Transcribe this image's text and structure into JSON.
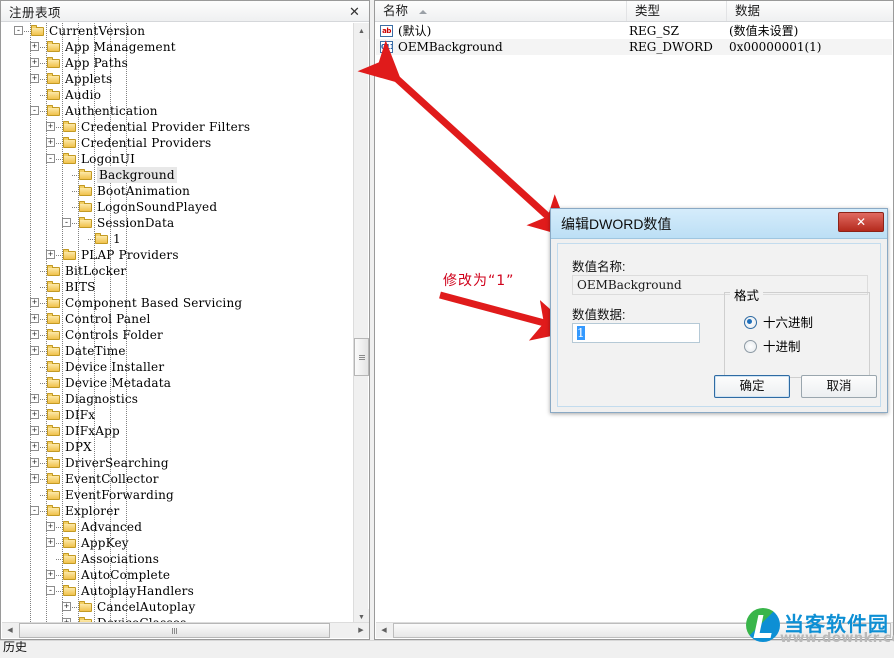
{
  "tree_panel": {
    "title": "注册表项",
    "close_label": "✕",
    "nodes": [
      {
        "depth": 5,
        "toggle": "-",
        "label": "CurrentVersion"
      },
      {
        "depth": 6,
        "toggle": "+",
        "label": "App Management"
      },
      {
        "depth": 6,
        "toggle": "+",
        "label": "App Paths"
      },
      {
        "depth": 6,
        "toggle": "+",
        "label": "Applets"
      },
      {
        "depth": 6,
        "toggle": "",
        "label": "Audio"
      },
      {
        "depth": 6,
        "toggle": "-",
        "label": "Authentication"
      },
      {
        "depth": 7,
        "toggle": "+",
        "label": "Credential Provider Filters"
      },
      {
        "depth": 7,
        "toggle": "+",
        "label": "Credential Providers"
      },
      {
        "depth": 7,
        "toggle": "-",
        "label": "LogonUI"
      },
      {
        "depth": 8,
        "toggle": "",
        "label": "Background",
        "selected": true
      },
      {
        "depth": 8,
        "toggle": "",
        "label": "BootAnimation"
      },
      {
        "depth": 8,
        "toggle": "",
        "label": "LogonSoundPlayed"
      },
      {
        "depth": 8,
        "toggle": "-",
        "label": "SessionData"
      },
      {
        "depth": 9,
        "toggle": "",
        "label": "1"
      },
      {
        "depth": 7,
        "toggle": "+",
        "label": "PLAP Providers"
      },
      {
        "depth": 6,
        "toggle": "",
        "label": "BitLocker"
      },
      {
        "depth": 6,
        "toggle": "",
        "label": "BITS"
      },
      {
        "depth": 6,
        "toggle": "+",
        "label": "Component Based Servicing"
      },
      {
        "depth": 6,
        "toggle": "+",
        "label": "Control Panel"
      },
      {
        "depth": 6,
        "toggle": "+",
        "label": "Controls Folder"
      },
      {
        "depth": 6,
        "toggle": "+",
        "label": "DateTime"
      },
      {
        "depth": 6,
        "toggle": "",
        "label": "Device Installer"
      },
      {
        "depth": 6,
        "toggle": "",
        "label": "Device Metadata"
      },
      {
        "depth": 6,
        "toggle": "+",
        "label": "Diagnostics"
      },
      {
        "depth": 6,
        "toggle": "+",
        "label": "DIFx"
      },
      {
        "depth": 6,
        "toggle": "+",
        "label": "DIFxApp"
      },
      {
        "depth": 6,
        "toggle": "+",
        "label": "DPX"
      },
      {
        "depth": 6,
        "toggle": "+",
        "label": "DriverSearching"
      },
      {
        "depth": 6,
        "toggle": "+",
        "label": "EventCollector"
      },
      {
        "depth": 6,
        "toggle": "",
        "label": "EventForwarding"
      },
      {
        "depth": 6,
        "toggle": "-",
        "label": "Explorer"
      },
      {
        "depth": 7,
        "toggle": "+",
        "label": "Advanced"
      },
      {
        "depth": 7,
        "toggle": "+",
        "label": "AppKey"
      },
      {
        "depth": 7,
        "toggle": "",
        "label": "Associations"
      },
      {
        "depth": 7,
        "toggle": "+",
        "label": "AutoComplete"
      },
      {
        "depth": 7,
        "toggle": "-",
        "label": "AutoplayHandlers"
      },
      {
        "depth": 8,
        "toggle": "+",
        "label": "CancelAutoplay"
      },
      {
        "depth": 8,
        "toggle": "+",
        "label": "DeviceClasses"
      }
    ],
    "scroll_up_glyph": "▲",
    "scroll_down_glyph": "▼",
    "scroll_left_glyph": "◀",
    "scroll_right_glyph": "▶"
  },
  "list_panel": {
    "columns": [
      {
        "label": "名称",
        "sorted": true
      },
      {
        "label": "类型"
      },
      {
        "label": "数据"
      }
    ],
    "rows": [
      {
        "icon": "ab-string-icon",
        "icon_text": "ab",
        "name": "(默认)",
        "type": "REG_SZ",
        "data": "(数值未设置)"
      },
      {
        "icon": "binary-dword-icon",
        "icon_text": "011",
        "name": "OEMBackground",
        "type": "REG_DWORD",
        "data": "0x00000001(1)"
      }
    ],
    "scroll_left_glyph": "◀"
  },
  "annotation": {
    "text": "修改为“1”",
    "color": "#d0021b"
  },
  "dialog": {
    "title": "编辑DWORD数值",
    "close_label": "✕",
    "name_label": "数值名称:",
    "name_value": "OEMBackground",
    "data_label": "数值数据:",
    "data_value": "1",
    "format_legend": "格式",
    "format_options": [
      {
        "label": "十六进制",
        "selected": true
      },
      {
        "label": "十进制",
        "selected": false
      }
    ],
    "ok_label": "确定",
    "cancel_label": "取消"
  },
  "statusbar": {
    "text": "历史"
  },
  "watermark": {
    "brand": "当客软件园",
    "url": "www.downkr.com"
  }
}
